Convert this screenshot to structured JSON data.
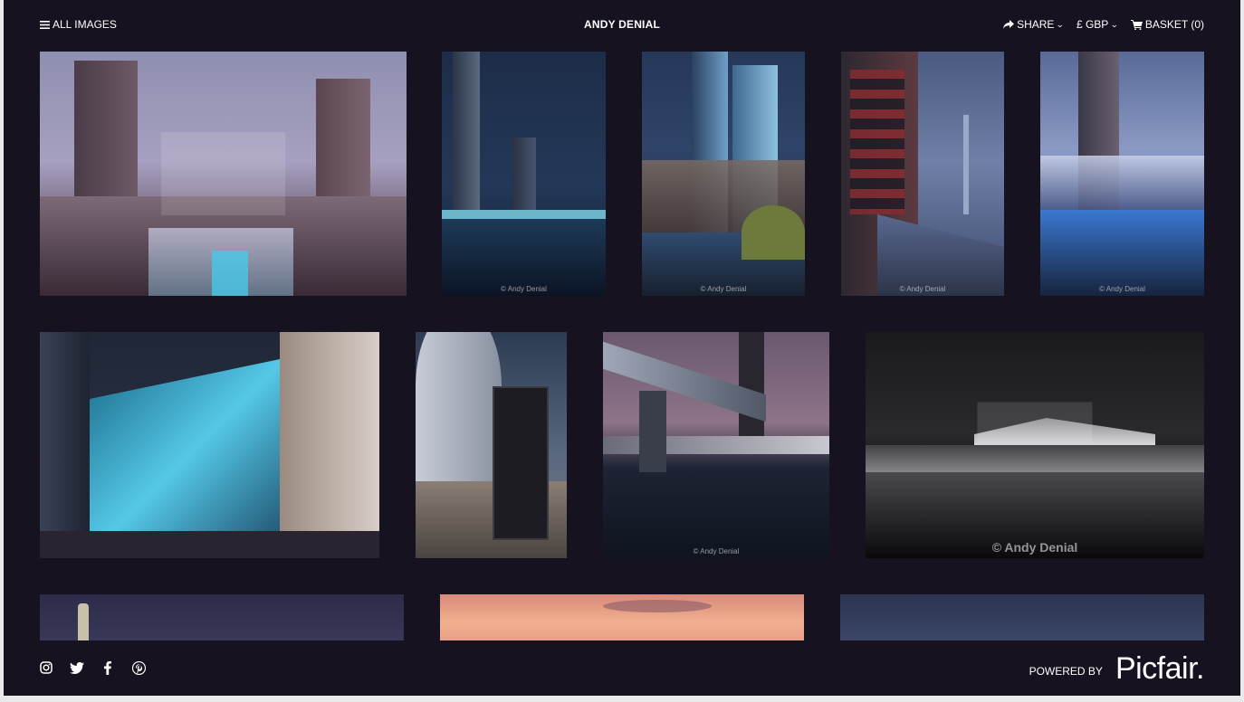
{
  "header": {
    "all_images": "ALL IMAGES",
    "title": "ANDY DENIAL",
    "share": "SHARE",
    "currency": "£ GBP",
    "basket": "BASKET (0)"
  },
  "watermark": {
    "credit": "© Andy Denial"
  },
  "footer": {
    "powered_by": "POWERED BY",
    "logo_text": "Picfair."
  },
  "icons": {
    "menu": "hamburger-icon",
    "share": "share-arrow-icon",
    "basket": "shopping-cart-icon",
    "social": [
      "instagram-icon",
      "twitter-icon",
      "facebook-icon",
      "pinterest-icon"
    ]
  }
}
